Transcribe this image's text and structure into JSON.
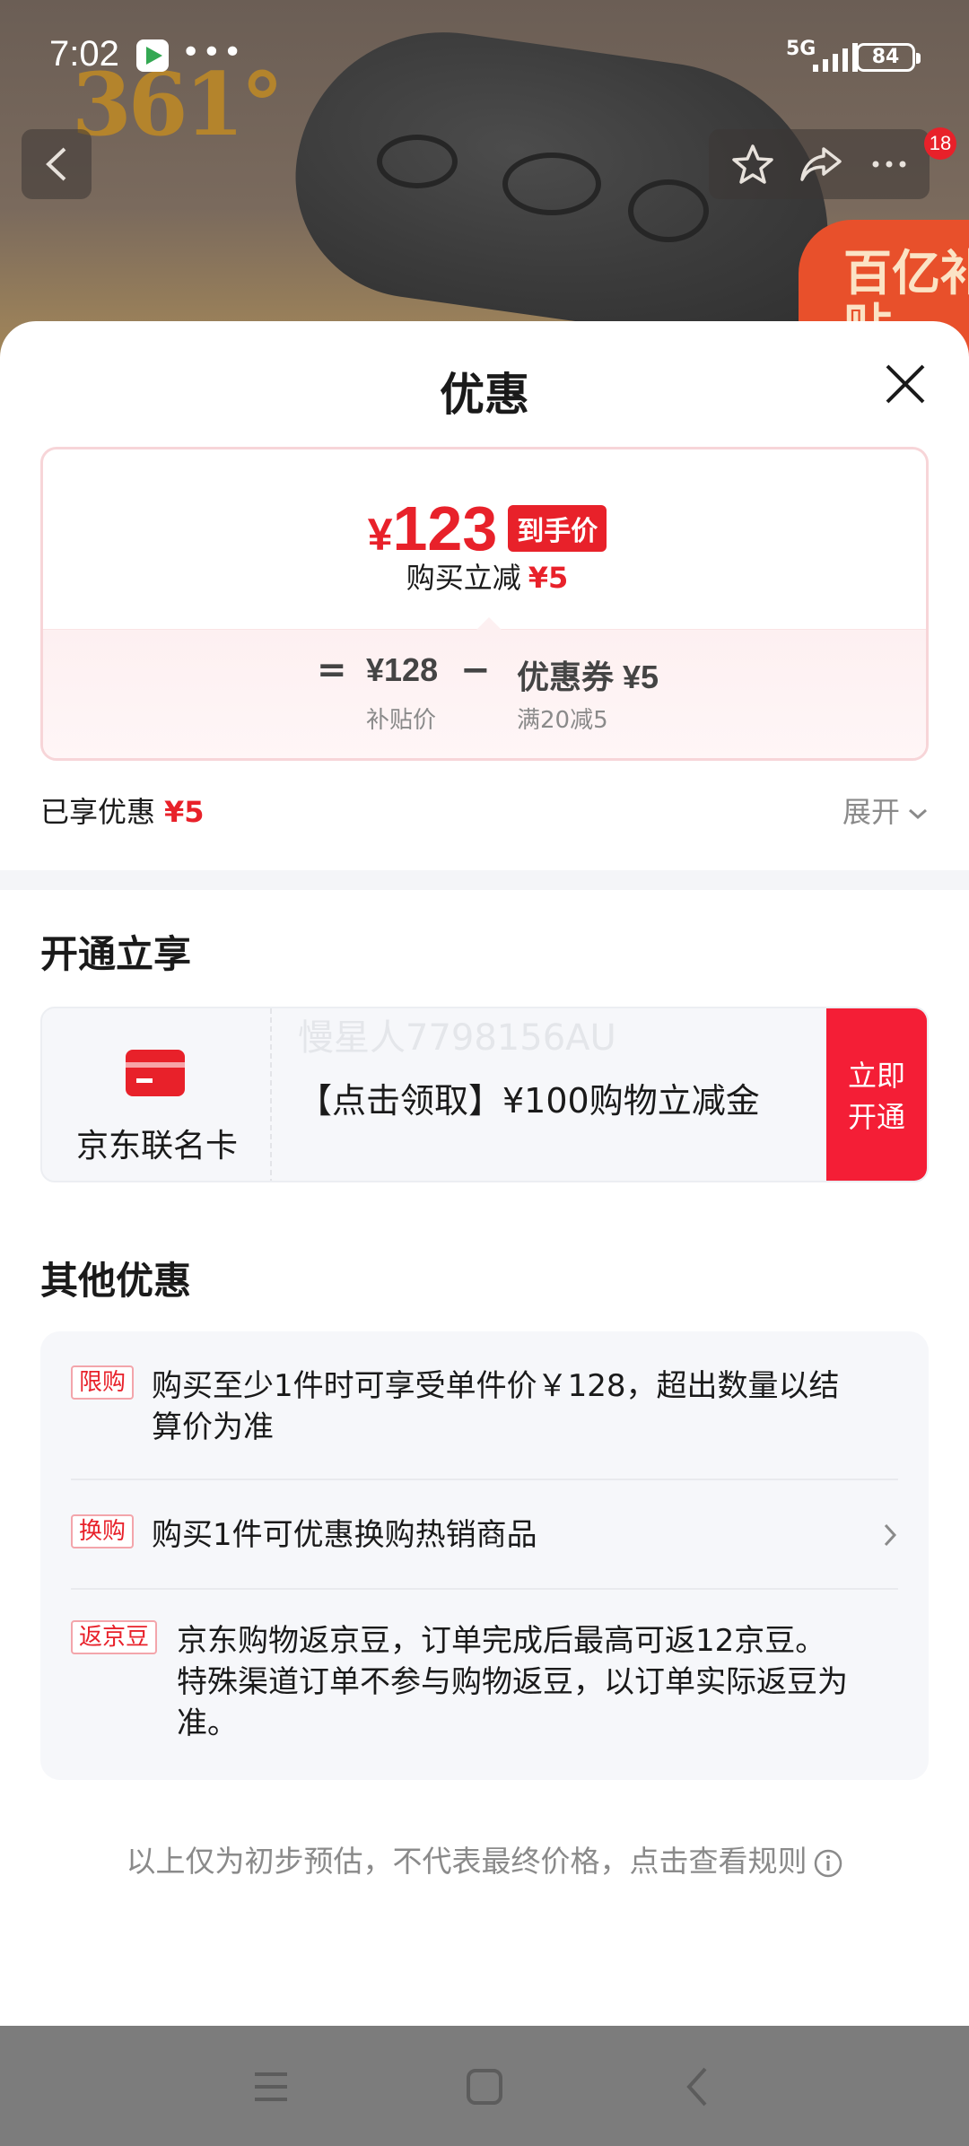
{
  "status_bar": {
    "time": "7:02",
    "dots": "•••",
    "network": "5G",
    "battery": "84"
  },
  "background": {
    "brand": "361°",
    "badge": "百亿补贴",
    "notification_count": "18"
  },
  "sheet": {
    "title": "优惠",
    "price_card": {
      "currency": "¥",
      "final_price": "123",
      "final_tag": "到手价",
      "reduce_label": "购买立减",
      "reduce_amount": "¥5",
      "equals": "=",
      "base_price": "¥128",
      "base_label": "补贴价",
      "minus": "−",
      "coupon": "优惠券 ¥5",
      "coupon_condition": "满20减5"
    },
    "enjoyed_label": "已享优惠",
    "enjoyed_amount": "¥5",
    "expand_label": "展开",
    "open_section_title": "开通立享",
    "member_card": {
      "name": "京东联名卡",
      "offer": "【点击领取】¥100购物立减金",
      "watermark": "慢星人7798156AU",
      "button_line1": "立即",
      "button_line2": "开通"
    },
    "other_section_title": "其他优惠",
    "other_offers": [
      {
        "tag": "限购",
        "line1": "购买至少1件时可享受单件价￥128，超出数量以结",
        "line2": "算价为准"
      },
      {
        "tag": "换购",
        "line1": "购买1件可优惠换购热销商品"
      },
      {
        "tag": "返京豆",
        "line1": "京东购物返京豆，订单完成后最高可返12京豆。",
        "line2": "特殊渠道订单不参与购物返豆，以订单实际返豆为",
        "line3": "准。"
      }
    ],
    "footnote": "以上仅为初步预估，不代表最终价格，点击查看规则"
  },
  "colors": {
    "accent": "#e8212a",
    "button_red": "#f41e36",
    "muted": "#8a8a8a"
  },
  "icons": [
    "back-icon",
    "star-icon",
    "share-icon",
    "more-icon",
    "close-icon",
    "chevron-down-icon",
    "chevron-right-icon",
    "info-icon",
    "menu-icon",
    "home-icon",
    "nav-back-icon"
  ]
}
